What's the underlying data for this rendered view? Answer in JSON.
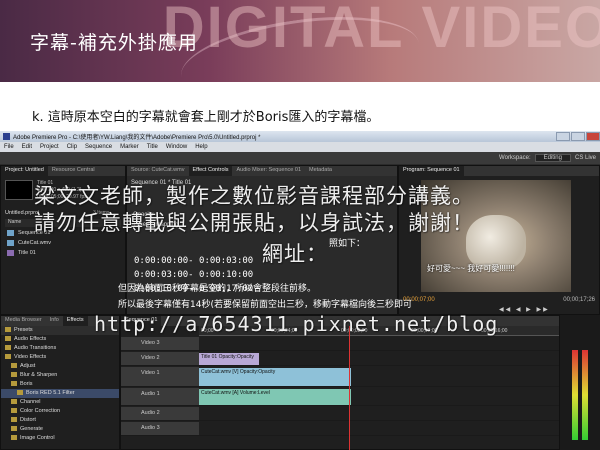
{
  "slide": {
    "title": "字幕-補充外掛應用",
    "banner": "DIGITAL VIDEO",
    "caption": "k. 這時原本空白的字幕就會套上剛才於Boris匯入的字幕檔。"
  },
  "app": {
    "window_title": "Adobe Premiere Pro - C:\\使用者\\YW.Liang\\我的文件\\Adobe\\Premiere Pro\\5.0\\Untitled.prproj *",
    "menu": [
      "File",
      "Edit",
      "Project",
      "Clip",
      "Sequence",
      "Marker",
      "Title",
      "Window",
      "Help"
    ],
    "workspace_label": "Workspace:",
    "workspace_value": "Editing",
    "cs_live": "CS Live",
    "project_panel": {
      "tabs": [
        "Project: Untitled",
        "Resource Central"
      ],
      "meta_line1": "Title 01",
      "meta_line2": "Still, 720 x 480 (1.2)",
      "meta_line3": "00;00;05;00, 29.97 fps",
      "file": "Untitled.prproj",
      "count": "3 Items",
      "col_name": "Name",
      "items": [
        "Sequence 01",
        "CuteCat.wmv",
        "Title 01"
      ]
    },
    "source_tabs": [
      "Source: CuteCat.wmv",
      "Effect Controls",
      "Audio Mixer: Sequence 01",
      "Metadata"
    ],
    "effect_controls": {
      "sequence_label": "Sequence 01 * Title 01",
      "opacity_label": "Opacity",
      "time_remap_label": "Time Remapping",
      "lines": [
        "0:00:00:00- 0:00:03:00",
        "0:00:03:00- 0:00:10:00",
        "0:00:10:00- 0:00:17:00"
      ],
      "note1": "但因為前面三秒字幕是空的，所以會整段往前移。",
      "note2": "所以最後字幕僅有14秒(若要保留前面空出三秒，移動字幕檔向後三秒即可",
      "note_suffix": "照如下："
    },
    "program_monitor": {
      "tab": "Program: Sequence 01",
      "subtitle": "好可愛~~~ 我好可愛!!!!!!!",
      "timecode": "00;00;07;00",
      "duration": "00;00;17;26"
    },
    "effects_panel": {
      "tabs": [
        "Media Browser",
        "Info",
        "Effects"
      ],
      "rows": [
        "Presets",
        "Audio Effects",
        "Audio Transitions",
        "Video Effects",
        "Adjust",
        "Blur & Sharpen",
        "Boris",
        "Boris RED 5.1 Filter",
        "Channel",
        "Color Correction",
        "Distort",
        "Generate",
        "Image Control"
      ]
    },
    "timeline": {
      "tracks": [
        {
          "name": "Video 3",
          "clip": ""
        },
        {
          "name": "Video 2",
          "clip": "Title 01 Opacity:Opacity"
        },
        {
          "name": "Video 1",
          "clip": "CuteCat.wmv [V] Opacity:Opacity"
        },
        {
          "name": "Audio 1",
          "clip": "CuteCat.wmv [A] Volume:Level"
        },
        {
          "name": "Audio 2",
          "clip": ""
        },
        {
          "name": "Audio 3",
          "clip": ""
        }
      ],
      "ruler": [
        "00;00",
        "00;00;04;00",
        "00;00;08;00",
        "00;00;12;00",
        "00;00;16;00"
      ]
    }
  },
  "watermark": {
    "line1": "梁文文老師，製作之數位影音課程部分講義。",
    "line2": "請勿任意轉載與公開張貼，以身試法，謝謝！",
    "line3": "網址：",
    "line4": "http://a7654311.pixnet.net/blog"
  }
}
